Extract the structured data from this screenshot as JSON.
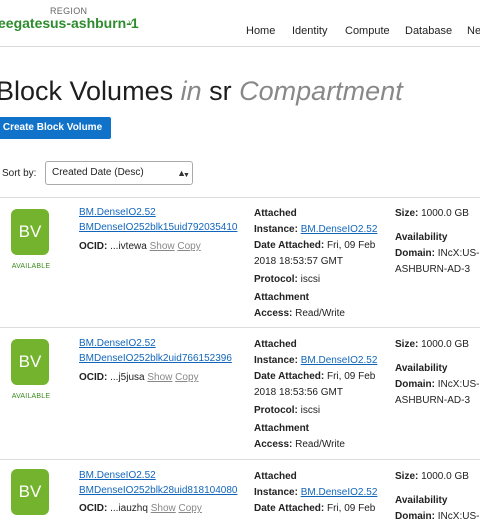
{
  "header": {
    "tenancy": "eegates",
    "region_label": "REGION",
    "region": "us-ashburn-1",
    "region_caret": "˅",
    "nav": [
      "Home",
      "Identity",
      "Compute",
      "Database",
      "Ne"
    ]
  },
  "page": {
    "title_main": "Block Volumes",
    "title_in": "in",
    "title_compartment_name": "sr",
    "title_compartment_word": "Compartment",
    "create_button": "Create Block Volume",
    "sort_label": "Sort by:",
    "sort_value": "Created Date (Desc)"
  },
  "labels": {
    "ocid": "OCID:",
    "show": "Show",
    "copy": "Copy",
    "attached": "Attached",
    "instance": "Instance:",
    "date_attached": "Date Attached:",
    "protocol": "Protocol:",
    "attachment": "Attachment",
    "access": "Access:",
    "size": "Size:",
    "availability": "Availability",
    "domain": "Domain:"
  },
  "volumes": [
    {
      "badge": "BV",
      "status": "AVAILABLE",
      "name_line1": "BM.DenseIO2.52",
      "name_line2": "BMDenseIO252blk15uid792035410",
      "ocid": "...ivtewa",
      "instance": "BM.DenseIO2.52",
      "date_line1": "Fri, 09 Feb",
      "date_line2": "2018 18:53:57 GMT",
      "protocol": "iscsi",
      "access": "Read/Write",
      "size": "1000.0 GB",
      "domain_line1": "INcX:US-",
      "domain_line2": "ASHBURN-AD-3"
    },
    {
      "badge": "BV",
      "status": "AVAILABLE",
      "name_line1": "BM.DenseIO2.52",
      "name_line2": "BMDenseIO252blk2uid766152396",
      "ocid": "...j5jusa",
      "instance": "BM.DenseIO2.52",
      "date_line1": "Fri, 09 Feb",
      "date_line2": "2018 18:53:56 GMT",
      "protocol": "iscsi",
      "access": "Read/Write",
      "size": "1000.0 GB",
      "domain_line1": "INcX:US-",
      "domain_line2": "ASHBURN-AD-3"
    },
    {
      "badge": "BV",
      "status": "",
      "name_line1": "BM.DenseIO2.52",
      "name_line2": "BMDenseIO252blk28uid818104080",
      "ocid": "...iauzhq",
      "instance": "BM.DenseIO2.52",
      "date_line1": "Fri, 09 Feb",
      "date_line2": "",
      "protocol": "",
      "access": "",
      "size": "1000.0 GB",
      "domain_line1": "INcX:US-",
      "domain_line2": ""
    }
  ]
}
